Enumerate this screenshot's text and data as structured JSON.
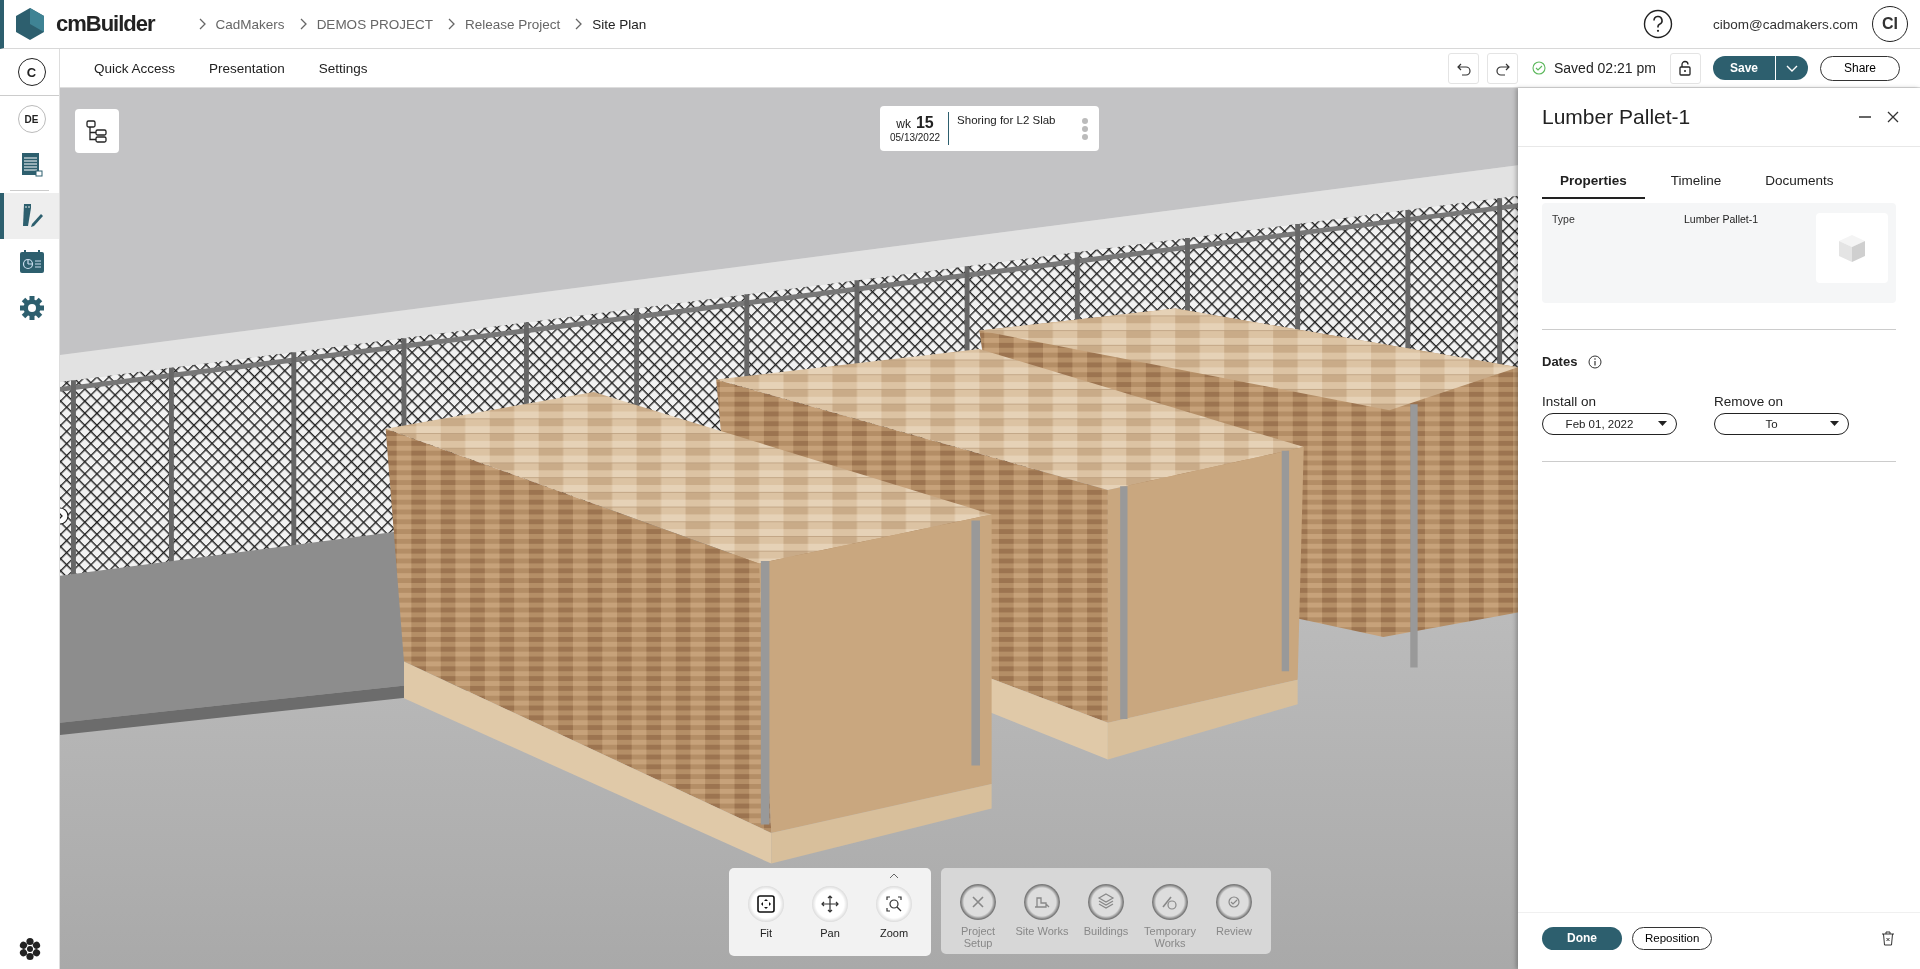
{
  "app": {
    "name": "cmBuilder"
  },
  "breadcrumb": [
    {
      "label": "CadMakers",
      "current": false
    },
    {
      "label": "DEMOS PROJECT",
      "current": false
    },
    {
      "label": "Release Project",
      "current": false
    },
    {
      "label": "Site Plan",
      "current": true
    }
  ],
  "user": {
    "email": "cibom@cadmakers.com",
    "initials": "CI"
  },
  "sidebar": {
    "items": [
      {
        "kind": "badge",
        "label": "C",
        "selected": false
      },
      {
        "kind": "badge",
        "label": "DE",
        "selected": false
      },
      {
        "kind": "document",
        "selected": false
      },
      {
        "kind": "design",
        "selected": true
      },
      {
        "kind": "schedule",
        "selected": false
      },
      {
        "kind": "settings",
        "selected": false
      }
    ]
  },
  "menu": {
    "items": [
      "Quick Access",
      "Presentation",
      "Settings"
    ]
  },
  "toolbar": {
    "status": "Saved 02:21 pm",
    "save": "Save",
    "share": "Share"
  },
  "timeline_card": {
    "week_label": "wk",
    "week": "15",
    "date": "05/13/2022",
    "task": "Shoring for L2 Slab"
  },
  "view_tools": [
    {
      "label": "Fit",
      "kind": "fit"
    },
    {
      "label": "Pan",
      "kind": "pan"
    },
    {
      "label": "Zoom",
      "kind": "zoom"
    }
  ],
  "modules": [
    {
      "label": "Project Setup",
      "kind": "setup",
      "disabled": true
    },
    {
      "label": "Site Works",
      "kind": "siteworks",
      "disabled": true
    },
    {
      "label": "Buildings",
      "kind": "buildings",
      "disabled": true
    },
    {
      "label": "Temporary Works",
      "kind": "temporary",
      "disabled": true
    },
    {
      "label": "Review",
      "kind": "review",
      "disabled": true
    }
  ],
  "panel": {
    "title": "Lumber Pallet-1",
    "tabs": [
      {
        "label": "Properties",
        "selected": true
      },
      {
        "label": "Timeline",
        "selected": false
      },
      {
        "label": "Documents",
        "selected": false
      }
    ],
    "properties": [
      {
        "label": "Type",
        "value": "Lumber Pallet-1"
      }
    ],
    "dates": {
      "title": "Dates",
      "install": {
        "label": "Install on",
        "value": "Feb 01, 2022"
      },
      "remove": {
        "label": "Remove on",
        "value": "To"
      }
    },
    "done": "Done",
    "reposition": "Reposition"
  }
}
